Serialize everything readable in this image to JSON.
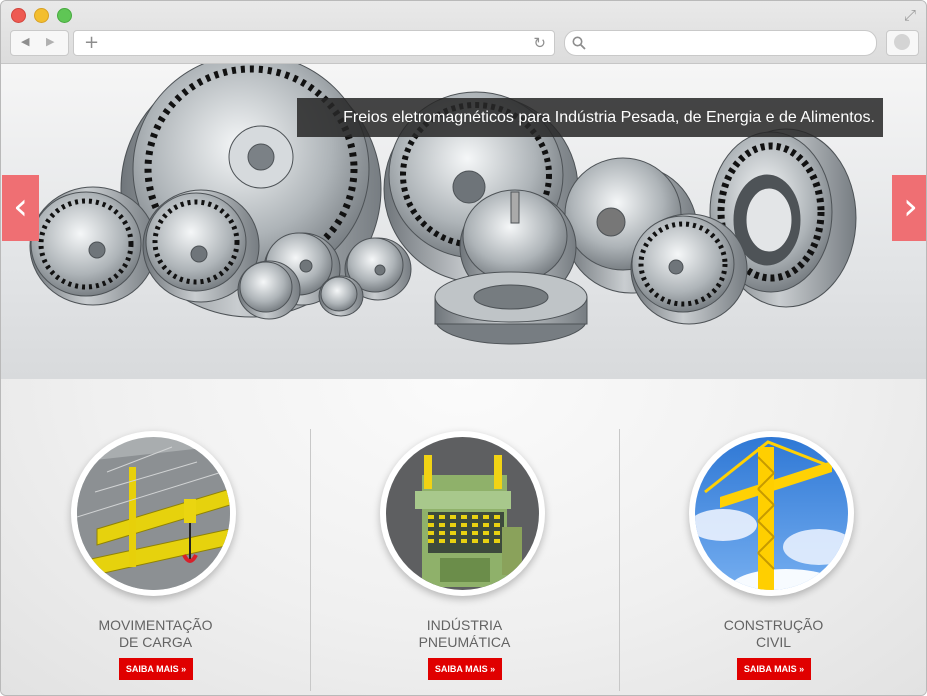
{
  "browser": {
    "controls": [
      "close",
      "minimize",
      "maximize"
    ],
    "icons": {
      "back": "left-triangle",
      "forward": "right-triangle",
      "new_tab": "plus",
      "reload": "reload-arrow",
      "search": "magnifier",
      "extension": "circle",
      "expand": "diagonal-arrows"
    },
    "address_value": "",
    "search_value": ""
  },
  "hero": {
    "caption": "Freios eletromagnéticos para Indústria Pesada, de Energia e de Alimentos.",
    "arrow_left": "‹",
    "arrow_right": "›"
  },
  "products": [
    {
      "line1": "MOVIMENTAÇÃO",
      "line2": "DE CARGA",
      "button": "SAIBA MAIS »",
      "image": "yellow overhead crane"
    },
    {
      "line1": "INDÚSTRIA",
      "line2": "PNEUMÁTICA",
      "button": "SAIBA MAIS »",
      "image": "green and yellow industrial press"
    },
    {
      "line1": "CONSTRUÇÃO",
      "line2": "CIVIL",
      "button": "SAIBA MAIS »",
      "image": "yellow tower crane against blue sky"
    }
  ],
  "colors": {
    "accent_red": "#e00000",
    "slider_arrow": "#ef6f73",
    "caption_bg": "#282828"
  }
}
